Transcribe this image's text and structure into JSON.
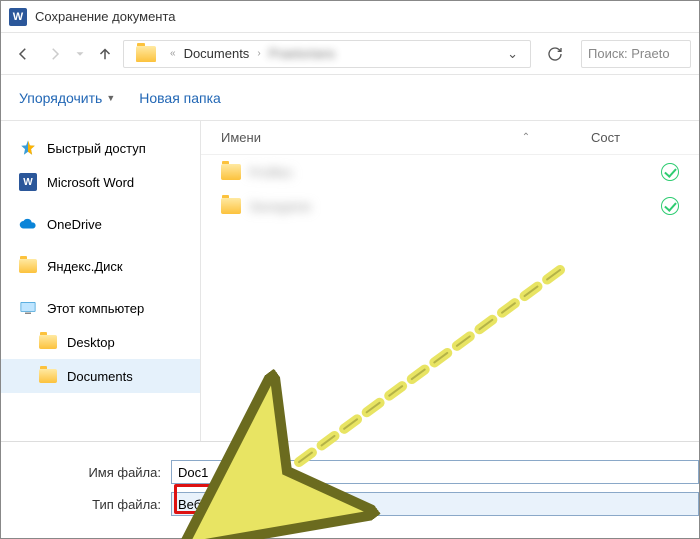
{
  "title": "Сохранение документа",
  "nav": {
    "breadcrumb_item": "Documents",
    "breadcrumb_blur": "Praetorians",
    "refresh": "⟳",
    "search_placeholder": "Поиск: Praeto"
  },
  "toolbar": {
    "organize": "Упорядочить",
    "new_folder": "Новая папка"
  },
  "sidebar": {
    "quick_access": "Быстрый доступ",
    "word": "Microsoft Word",
    "onedrive": "OneDrive",
    "yadisk": "Яндекс.Диск",
    "this_pc": "Этот компьютер",
    "desktop": "Desktop",
    "documents": "Documents"
  },
  "filelist": {
    "col_name": "Имени",
    "col_state": "Сост",
    "rows": [
      {
        "name": "Profiles",
        "ok": true
      },
      {
        "name": "Savegame",
        "ok": true
      }
    ]
  },
  "fields": {
    "filename_label": "Имя файла:",
    "filename_value": "Doc1",
    "filetype_label": "Тип файла:",
    "filetype_value": "Веб-страница"
  }
}
